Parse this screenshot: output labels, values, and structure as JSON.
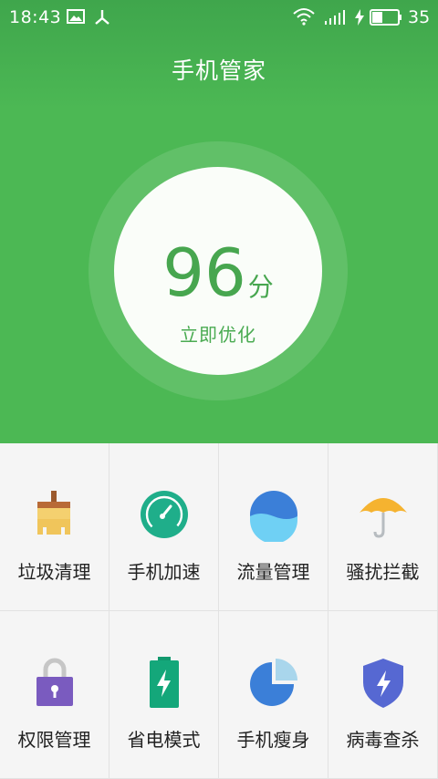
{
  "status_bar": {
    "time": "18:43",
    "battery": "35"
  },
  "header": {
    "title": "手机管家"
  },
  "score": {
    "value": "96",
    "unit": "分",
    "action": "立即优化"
  },
  "grid": [
    {
      "label": "垃圾清理",
      "icon": "broom-icon"
    },
    {
      "label": "手机加速",
      "icon": "speedometer-icon"
    },
    {
      "label": "流量管理",
      "icon": "water-wave-icon"
    },
    {
      "label": "骚扰拦截",
      "icon": "umbrella-icon"
    },
    {
      "label": "权限管理",
      "icon": "padlock-icon"
    },
    {
      "label": "省电模式",
      "icon": "battery-icon"
    },
    {
      "label": "手机瘦身",
      "icon": "pie-chart-icon"
    },
    {
      "label": "病毒查杀",
      "icon": "shield-icon"
    }
  ],
  "colors": {
    "header_green": "#4cb854",
    "score_green": "#47a64f"
  }
}
